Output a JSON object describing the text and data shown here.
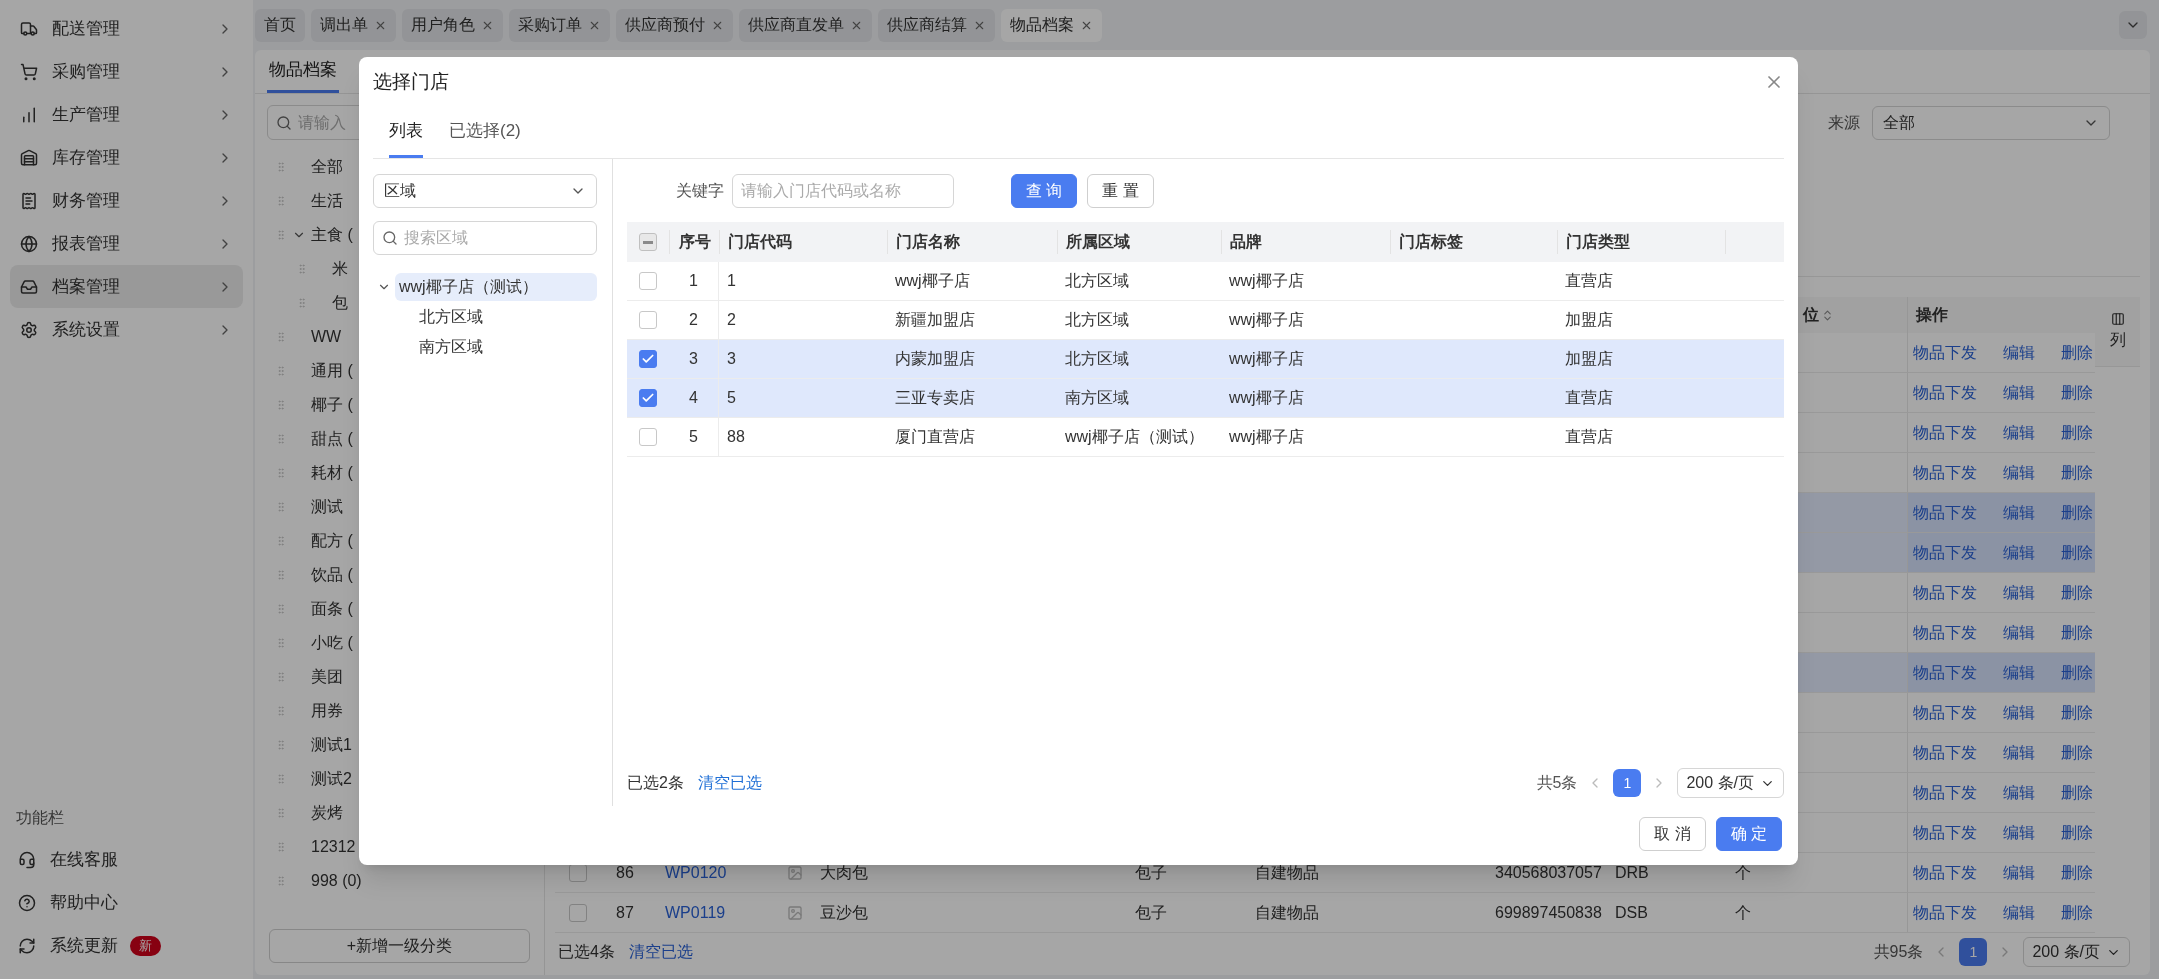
{
  "sidebar": {
    "items": [
      {
        "label": "配送管理",
        "selected": false
      },
      {
        "label": "采购管理",
        "selected": false
      },
      {
        "label": "生产管理",
        "selected": false
      },
      {
        "label": "库存管理",
        "selected": false
      },
      {
        "label": "财务管理",
        "selected": false
      },
      {
        "label": "报表管理",
        "selected": false
      },
      {
        "label": "档案管理",
        "selected": true
      },
      {
        "label": "系统设置",
        "selected": false
      }
    ],
    "footer": {
      "title": "功能栏",
      "items": [
        {
          "label": "在线客服"
        },
        {
          "label": "帮助中心"
        },
        {
          "label": "系统更新",
          "badge": "新"
        }
      ]
    }
  },
  "tabs": [
    {
      "label": "首页",
      "closable": false,
      "selected": false
    },
    {
      "label": "调出单",
      "closable": true,
      "selected": false
    },
    {
      "label": "用户角色",
      "closable": true,
      "selected": false
    },
    {
      "label": "采购订单",
      "closable": true,
      "selected": false
    },
    {
      "label": "供应商预付",
      "closable": true,
      "selected": false
    },
    {
      "label": "供应商直发单",
      "closable": true,
      "selected": false
    },
    {
      "label": "供应商结算",
      "closable": true,
      "selected": false
    },
    {
      "label": "物品档案",
      "closable": true,
      "selected": true
    }
  ],
  "page": {
    "tabs": [
      {
        "label": "物品档案",
        "selected": true
      }
    ],
    "category_search": {
      "placeholder": "请输入"
    },
    "category_tree": [
      {
        "label": "全部",
        "expanded": false
      },
      {
        "label": "生活",
        "expanded": false
      },
      {
        "label": "主食 (",
        "expanded": true,
        "children": [
          {
            "label": "米",
            "expanded": false
          },
          {
            "label": "包",
            "expanded": false
          }
        ]
      },
      {
        "label": "WW",
        "expanded": false
      },
      {
        "label": "通用 (",
        "expanded": false
      },
      {
        "label": "椰子 (",
        "expanded": false
      },
      {
        "label": "甜点 (",
        "expanded": false
      },
      {
        "label": "耗材 (",
        "expanded": false
      },
      {
        "label": "测试",
        "expanded": false
      },
      {
        "label": "配方 (",
        "expanded": false
      },
      {
        "label": "饮品 (",
        "expanded": false
      },
      {
        "label": "面条 (",
        "expanded": false
      },
      {
        "label": "小吃 (",
        "expanded": false
      },
      {
        "label": "美团",
        "expanded": false
      },
      {
        "label": "用券",
        "expanded": false
      },
      {
        "label": "测试1",
        "expanded": false
      },
      {
        "label": "测试2",
        "expanded": false
      },
      {
        "label": "炭烤",
        "expanded": false
      },
      {
        "label": "12312",
        "expanded": false
      },
      {
        "label": "998 (0)",
        "expanded": false
      }
    ],
    "add_button": "+新增一级分类",
    "filter": {
      "label": "来源",
      "value": "全部"
    },
    "table": {
      "columns": {
        "unit": {
          "label": "位",
          "sortable": true
        },
        "actions": "操作"
      },
      "column_settings": "列",
      "rows": [
        {
          "selected": false,
          "actions": [
            "物品下发",
            "编辑",
            "删除"
          ]
        },
        {
          "selected": false,
          "actions": [
            "物品下发",
            "编辑",
            "删除"
          ]
        },
        {
          "selected": false,
          "actions": [
            "物品下发",
            "编辑",
            "删除"
          ]
        },
        {
          "selected": false,
          "actions": [
            "物品下发",
            "编辑",
            "删除"
          ]
        },
        {
          "selected": true,
          "actions": [
            "物品下发",
            "编辑",
            "删除"
          ]
        },
        {
          "selected": true,
          "actions": [
            "物品下发",
            "编辑",
            "删除"
          ]
        },
        {
          "selected": false,
          "actions": [
            "物品下发",
            "编辑",
            "删除"
          ]
        },
        {
          "selected": false,
          "actions": [
            "物品下发",
            "编辑",
            "删除"
          ]
        },
        {
          "selected": true,
          "actions": [
            "物品下发",
            "编辑",
            "删除"
          ]
        },
        {
          "selected": false,
          "actions": [
            "物品下发",
            "编辑",
            "删除"
          ]
        },
        {
          "selected": false,
          "actions": [
            "物品下发",
            "编辑",
            "删除"
          ]
        },
        {
          "selected": false,
          "actions": [
            "物品下发",
            "编辑",
            "删除"
          ]
        },
        {
          "selected": false,
          "actions": [
            "物品下发",
            "编辑",
            "删除"
          ]
        },
        {
          "selected": false,
          "checked": false,
          "no": "86",
          "code": "WP0120",
          "name": "大肉包",
          "category": "包子",
          "source": "自建物品",
          "barcode": "340568037057",
          "code_2": "DRB",
          "unit": "个",
          "actions": [
            "物品下发",
            "编辑",
            "删除"
          ]
        },
        {
          "selected": false,
          "checked": false,
          "no": "87",
          "code": "WP0119",
          "name": "豆沙包",
          "category": "包子",
          "source": "自建物品",
          "barcode": "699897450838",
          "code_2": "DSB",
          "unit": "个",
          "actions": [
            "物品下发",
            "编辑",
            "删除"
          ]
        }
      ]
    },
    "footer": {
      "selected_count": "已选4条",
      "clear": "清空已选",
      "total": "共95条",
      "page": "1",
      "page_size": "200 条/页"
    }
  },
  "dialog": {
    "title": "选择门店",
    "tabs": [
      {
        "label": "列表",
        "selected": true
      },
      {
        "label": "已选择(2)",
        "selected": false
      }
    ],
    "region_select": {
      "value": "区域"
    },
    "region_search": {
      "placeholder": "搜索区域"
    },
    "region_tree": [
      {
        "label": "wwj椰子店（测试）",
        "expanded": true,
        "selected": true,
        "children": [
          {
            "label": "北方区域",
            "selected": false
          },
          {
            "label": "南方区域",
            "selected": false
          }
        ]
      }
    ],
    "keyword": {
      "label": "关键字",
      "placeholder": "请输入门店代码或名称"
    },
    "buttons": [
      {
        "label": "查 询",
        "kind": "primary"
      },
      {
        "label": "重 置",
        "kind": "default"
      }
    ],
    "table": {
      "select_all": {
        "indeterminate": true
      },
      "columns": [
        "序号",
        "门店代码",
        "门店名称",
        "所属区域",
        "品牌",
        "门店标签",
        "门店类型"
      ],
      "rows": [
        {
          "checked": false,
          "no": "1",
          "code": "1",
          "name": "wwj椰子店",
          "region": "北方区域",
          "brand": "wwj椰子店",
          "store_type": "直营店"
        },
        {
          "checked": false,
          "no": "2",
          "code": "2",
          "name": "新疆加盟店",
          "region": "北方区域",
          "brand": "wwj椰子店",
          "store_type": "加盟店"
        },
        {
          "checked": true,
          "no": "3",
          "code": "3",
          "name": "内蒙加盟店",
          "region": "北方区域",
          "brand": "wwj椰子店",
          "store_type": "加盟店"
        },
        {
          "checked": true,
          "no": "4",
          "code": "5",
          "name": "三亚专卖店",
          "region": "南方区域",
          "brand": "wwj椰子店",
          "store_type": "直营店"
        },
        {
          "checked": false,
          "no": "5",
          "code": "88",
          "name": "厦门直营店",
          "region": "wwj椰子店（测试）",
          "brand": "wwj椰子店",
          "store_type": "直营店"
        }
      ]
    },
    "footer": {
      "selected_count": "已选2条",
      "clear": "清空已选",
      "total": "共5条",
      "page": "1",
      "page_size": "200 条/页"
    },
    "actions": [
      {
        "label": "取 消",
        "kind": "default"
      },
      {
        "label": "确 定",
        "kind": "primary"
      }
    ]
  }
}
